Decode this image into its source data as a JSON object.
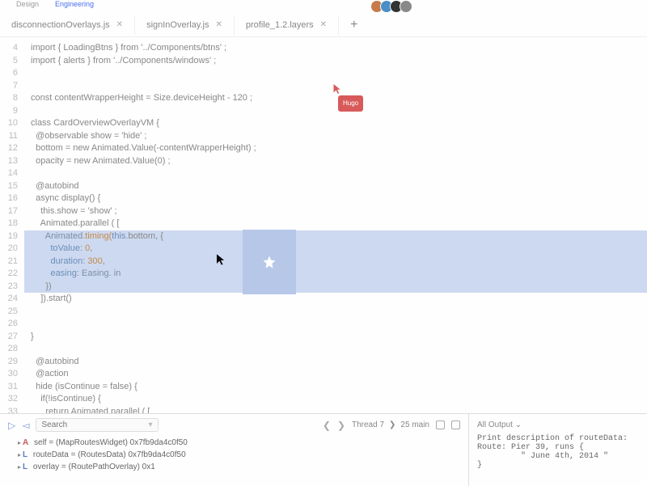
{
  "nav": {
    "design": "Design",
    "engineering": "Engineering"
  },
  "tabs": [
    {
      "label": "disconnectionOverlays.js"
    },
    {
      "label": "signInOverlay.js"
    },
    {
      "label": "profile_1.2.layers"
    }
  ],
  "remote_cursor": {
    "label": "Hugo"
  },
  "gutter_start": 4,
  "gutter_end": 33,
  "code": {
    "l4": "import { LoadingBtns } from '../Components/btns' ;",
    "l5": "import { alerts } from '../Components/windows' ;",
    "l8": "const contentWrapperHeight = Size.deviceHeight - 120 ;",
    "l10": "class CardOverviewOverlayVM {",
    "l11": "  @observable show = 'hide' ;",
    "l12": "  bottom = new Animated.Value(-contentWrapperHeight) ;",
    "l13": "  opacity = new Animated.Value(0) ;",
    "l15": "  @autobind",
    "l16": "  async display() {",
    "l17": "    this.show = 'show' ;",
    "l18": "    Animated.parallel ( [",
    "l19a": "      Animated",
    "l19b": ".timing(",
    "l19c": "this",
    "l19d": ".bottom, {",
    "l20a": "        toValue",
    "l20b": ": ",
    "l20c": "0",
    "l20d": ",",
    "l21a": "        duration",
    "l21b": ": ",
    "l21c": "300",
    "l21d": ",",
    "l22a": "        easing",
    "l22b": ": ",
    "l22c": "Easing. in",
    "l23": "      })",
    "l24": "    ]).start()",
    "l27": "}",
    "l29": "  @autobind",
    "l30": "  @action",
    "l31": "  hide (isContinue = false) {",
    "l32": "    if(!isContinue) {",
    "l33": "      return Animated.parallel ( ["
  },
  "debug": {
    "search_placeholder": "Search",
    "thread": "Thread 7",
    "frame": "25 main",
    "vars": [
      {
        "kind": "A",
        "name": "self",
        "val": "(MapRoutesWidget) 0x7fb9da4c0f50"
      },
      {
        "kind": "L",
        "name": "routeData",
        "val": "(RoutesData) 0x7fb9da4c0f50"
      },
      {
        "kind": "L",
        "name": "overlay",
        "val": "(RoutePathOverlay) 0x1"
      }
    ]
  },
  "output": {
    "header": "All Output",
    "l1": "Print description of routeData:",
    "l2": "Route: Pier 39, runs {",
    "l3": "         \" June 4th, 2014 \"",
    "l4": "}"
  }
}
